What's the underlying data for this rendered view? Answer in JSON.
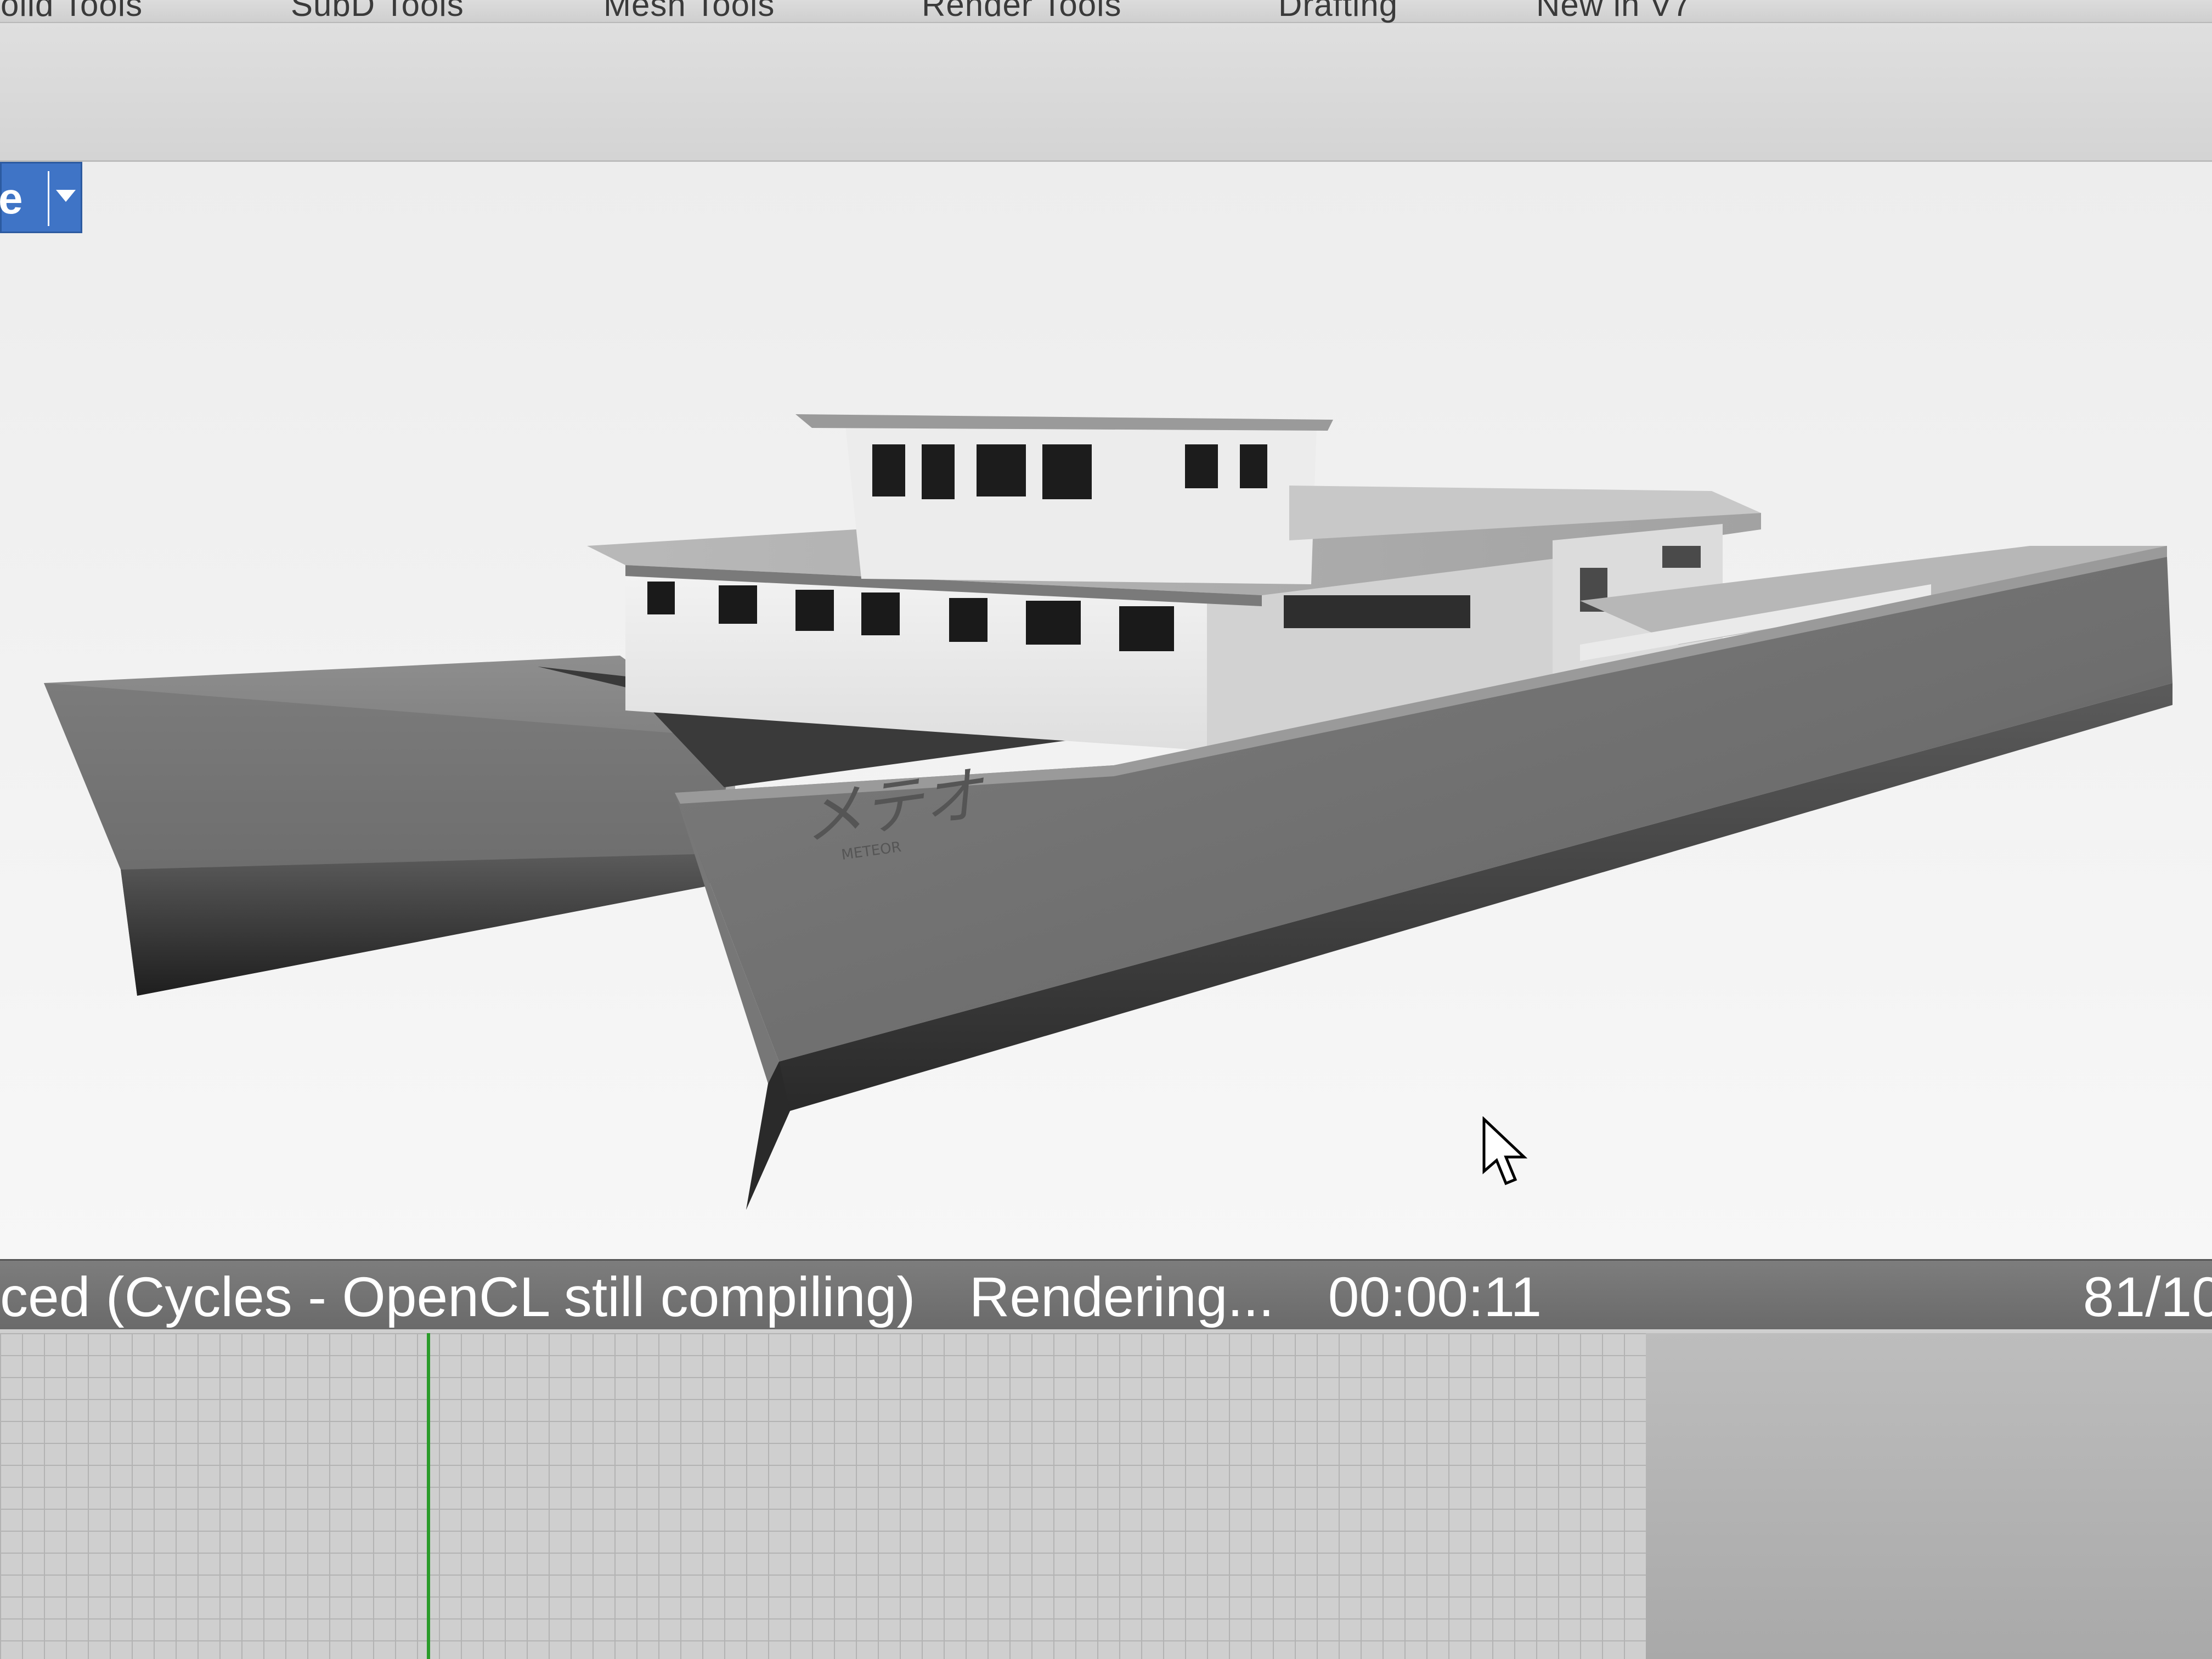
{
  "menu": {
    "tabs": [
      {
        "label": "Solid Tools"
      },
      {
        "label": "SubD Tools"
      },
      {
        "label": "Mesh Tools"
      },
      {
        "label": "Render Tools"
      },
      {
        "label": "Drafting"
      },
      {
        "label": "New in V7"
      }
    ]
  },
  "viewport": {
    "name_fragment": "e",
    "hull_name": "メテオ",
    "hull_subname": "METEOR"
  },
  "status": {
    "mode": "ced (Cycles - OpenCL still compiling)",
    "state": "Rendering...",
    "elapsed": "00:00:11",
    "pass_counter": "81/10"
  },
  "colors": {
    "accent": "#3f74c6",
    "status_bar": "#707070",
    "playhead": "#2a9b2a"
  }
}
